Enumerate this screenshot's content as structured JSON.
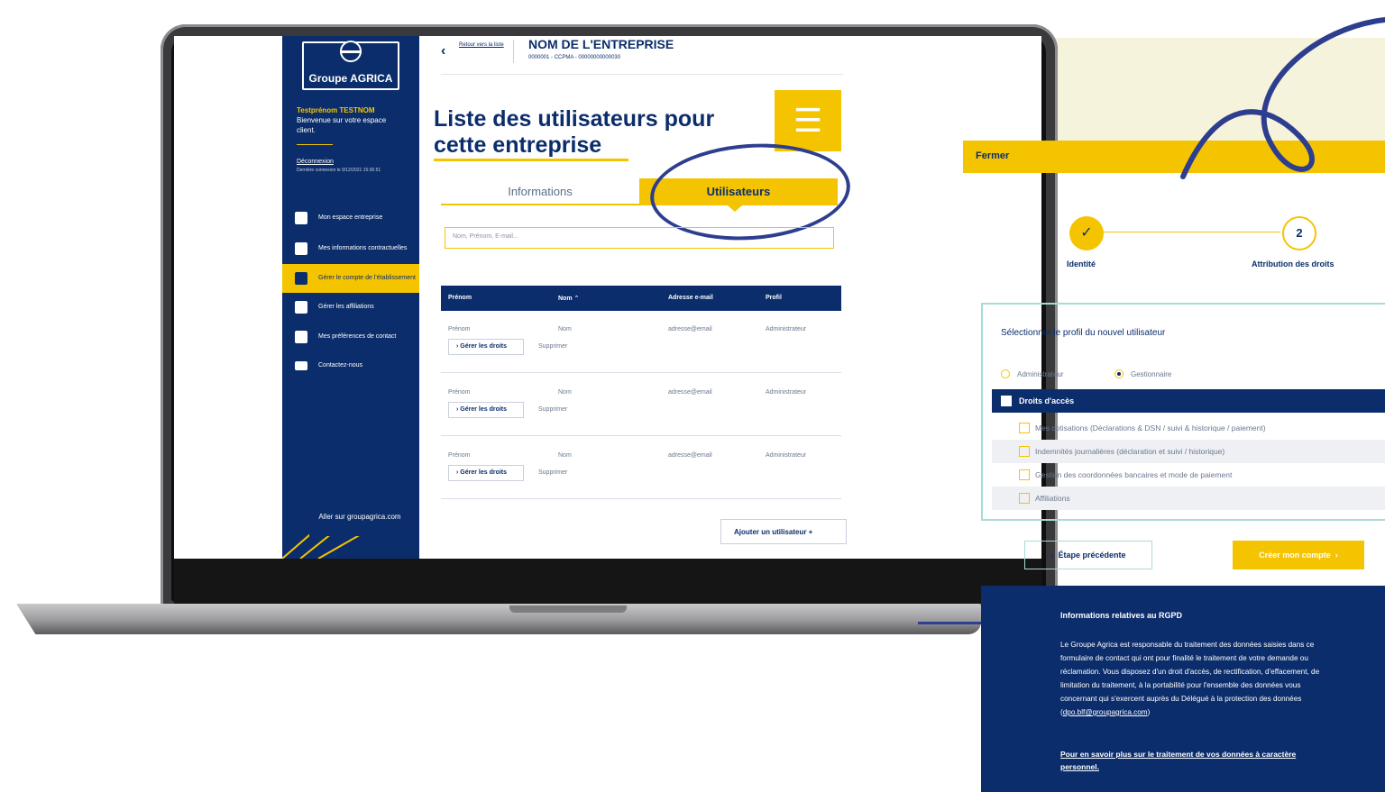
{
  "sidebar": {
    "logo": "Groupe AGRICA",
    "user_name": "Testprénom TESTNOM",
    "welcome": "Bienvenue sur votre espace client.",
    "logout": "Déconnexion",
    "last_login": "Dernière connexion le 9/12/2021 15:36:51",
    "items": [
      {
        "label": "Mon espace entreprise",
        "icon": "building-icon"
      },
      {
        "label": "Mes informations contractuelles",
        "icon": "document-edit-icon"
      },
      {
        "label": "Gérer le compte de l'établissement",
        "icon": "users-icon"
      },
      {
        "label": "Gérer les affiliations",
        "icon": "document-edit-icon"
      },
      {
        "label": "Mes préférences de contact",
        "icon": "document-icon"
      },
      {
        "label": "Contactez-nous",
        "icon": "mail-icon"
      }
    ],
    "goto": "Aller sur groupagrica.com"
  },
  "header": {
    "back_label": "Retour vers la liste",
    "company_name": "NOM DE L'ENTREPRISE",
    "company_sub": "0000001 - CCPMA - 00000000000030"
  },
  "main": {
    "title": "Liste des utilisateurs pour cette entreprise",
    "tabs": [
      "Informations",
      "Utilisateurs"
    ],
    "search_placeholder": "Nom, Prénom, E-mail...",
    "columns": [
      "Prénom",
      "Nom ⌃",
      "Adresse e-mail",
      "Profil"
    ],
    "rows": [
      {
        "prenom": "Prénom",
        "nom": "Nom",
        "email": "adresse@email",
        "profil": "Administrateur"
      },
      {
        "prenom": "Prénom",
        "nom": "Nom",
        "email": "adresse@email",
        "profil": "Administrateur"
      },
      {
        "prenom": "Prénom",
        "nom": "Nom",
        "email": "adresse@email",
        "profil": "Administrateur"
      }
    ],
    "manage_rights": "Gérer les droits",
    "delete": "Supprimer",
    "add_user": "Ajouter un utilisateur +"
  },
  "panel": {
    "close": "Fermer",
    "step1_label": "Identité",
    "step2_number": "2",
    "step2_label": "Attribution des droits",
    "profile_title": "Sélectionner le profil du nouvel utilisateur",
    "radio_admin": "Administrateur",
    "radio_manager": "Gestionnaire",
    "rights_header": "Droits d'accès",
    "rights": [
      "Mes cotisations (Déclarations & DSN / suivi & historique / paiement)",
      "Indemnités journalières (déclaration et suivi / historique)",
      "Gestion des coordonnées bancaires et mode de paiement",
      "Affiliations"
    ],
    "prev": "Étape précédente",
    "create": "Créer mon compte"
  },
  "rgpd": {
    "title": "Informations relatives au RGPD",
    "text": "Le Groupe Agrica est responsable du traitement des données saisies dans ce formulaire de contact qui ont pour finalité le traitement de votre demande ou réclamation. Vous disposez d'un droit d'accès, de rectification, d'effacement, de limitation du traitement, à la portabilité pour l'ensemble des données vous concernant qui s'exercent auprès du Délégué à la protection des données",
    "email": "dpo.blf@groupagrica.com",
    "link": "Pour en savoir plus sur le traitement de vos données à caractère personnel."
  },
  "colors": {
    "navy": "#0b2d6b",
    "yellow": "#f5c400",
    "teal": "#a7dcd6"
  }
}
